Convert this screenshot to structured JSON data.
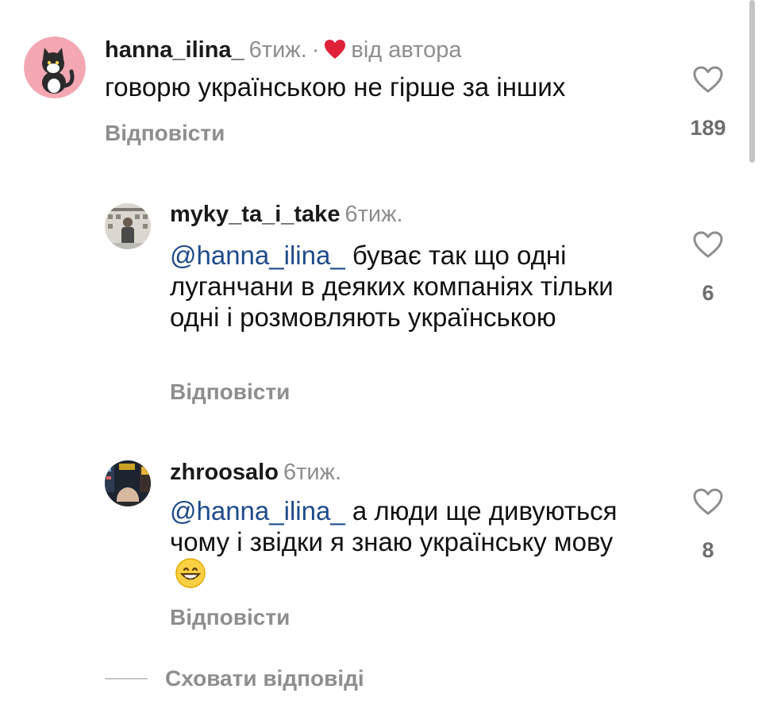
{
  "comments": [
    {
      "username": "hanna_ilina_",
      "time": "6тиж.",
      "separator": "·",
      "author_like_label": "від автора",
      "author_like_icon": "red-heart-icon",
      "text": "говорю українською не гірше за інших",
      "reply_label": "Відповісти",
      "likes": "189"
    },
    {
      "username": "myky_ta_i_take",
      "time": "6тиж.",
      "mention": "@hanna_ilina_",
      "text": "буває так що одні луганчани в деяких компаніях тільки одні і розмовляють українською",
      "reply_label": "Відповісти",
      "likes": "6"
    },
    {
      "username": "zhroosalo",
      "time": "6тиж.",
      "mention": "@hanna_ilina_",
      "text": "а люди ще дивуються чому і звідки я знаю українську мову",
      "emoji": "grinning-face-emoji",
      "reply_label": "Відповісти",
      "likes": "8"
    }
  ],
  "hide_replies_label": "Сховати відповіді",
  "colors": {
    "mention": "#1e4a8a",
    "muted": "#8e8e8e",
    "author_heart": "#e0213a",
    "text": "#111111"
  }
}
